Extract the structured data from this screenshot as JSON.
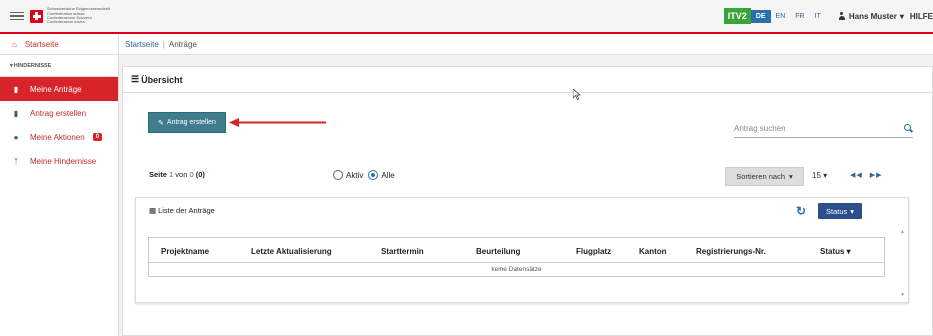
{
  "header": {
    "confederation_lines": [
      "Schweizerische Eidgenossenschaft",
      "Confédération suisse",
      "Confederazione Svizzera",
      "Confederaziun svizra"
    ],
    "app_badge": "ITV2",
    "languages": [
      "DE",
      "EN",
      "FR",
      "IT"
    ],
    "active_language": "DE",
    "user_name": "Hans Muster",
    "help_label": "HILFE"
  },
  "sidebar": {
    "home": "Startseite",
    "section": "HINDERNISSE",
    "items": [
      {
        "label": "Meine Anträge",
        "icon": "document-icon",
        "active": true
      },
      {
        "label": "Antrag erstellen",
        "icon": "document-icon"
      },
      {
        "label": "Meine Aktionen",
        "icon": "user-icon",
        "badge": "0"
      },
      {
        "label": "Meine Hindernisse",
        "icon": "antenna-icon"
      }
    ]
  },
  "breadcrumb": {
    "home": "Startseite",
    "separator": "|",
    "current": "Anträge"
  },
  "main": {
    "title": "Übersicht",
    "create_button": "Antrag erstellen",
    "search_placeholder": "Antrag suchen",
    "page_label": "Seite",
    "page_current": "1",
    "page_of": "von",
    "page_total": "0",
    "record_count": "(0)",
    "filter_active": "Aktiv",
    "filter_all": "Alle",
    "filter_selected": "Alle",
    "sort_label": "Sortieren nach",
    "page_size": "15",
    "list_title": "Liste der Anträge",
    "status_button": "Status",
    "table": {
      "columns": [
        "Projektname",
        "Letzte Aktualisierung",
        "Starttermin",
        "Beurteilung",
        "Flugplatz",
        "Kanton",
        "Registrierungs-Nr.",
        "Status"
      ],
      "empty_text": "keine Datensätze"
    }
  },
  "colors": {
    "accent_red": "#dc0018",
    "primary_blue": "#2b6fa8",
    "create_button": "#3f7c8c",
    "app_badge": "#3aa33a"
  }
}
